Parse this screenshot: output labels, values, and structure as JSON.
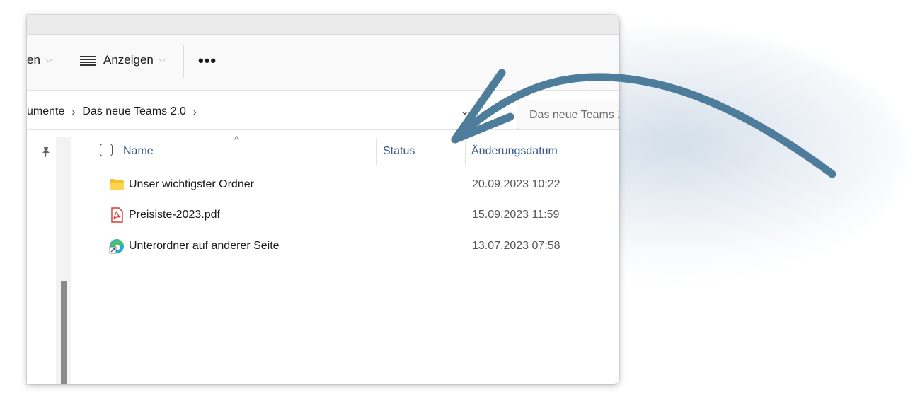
{
  "toolbar": {
    "partial_item_label": "en",
    "view_label": "Anzeigen",
    "more_label": "•••"
  },
  "address": {
    "crumbs": [
      "umente",
      "Das neue Teams 2.0"
    ],
    "separator": "›",
    "search_placeholder": "Das neue Teams 2"
  },
  "columns": {
    "name": "Name",
    "status": "Status",
    "modified": "Änderungsdatum"
  },
  "files": [
    {
      "name": "Unser wichtigster Ordner",
      "date": "20.09.2023 10:22",
      "icon": "folder-icon"
    },
    {
      "name": "Preisiste-2023.pdf",
      "date": "15.09.2023 11:59",
      "icon": "pdf-icon"
    },
    {
      "name": "Unterordner auf anderer Seite",
      "date": "13.07.2023 07:58",
      "icon": "edge-shortcut-icon"
    }
  ],
  "colors": {
    "arrow": "#4e7c9b",
    "header_text": "#3a5a8a",
    "folder": "#f2c230",
    "pdf": "#d63c2f"
  }
}
